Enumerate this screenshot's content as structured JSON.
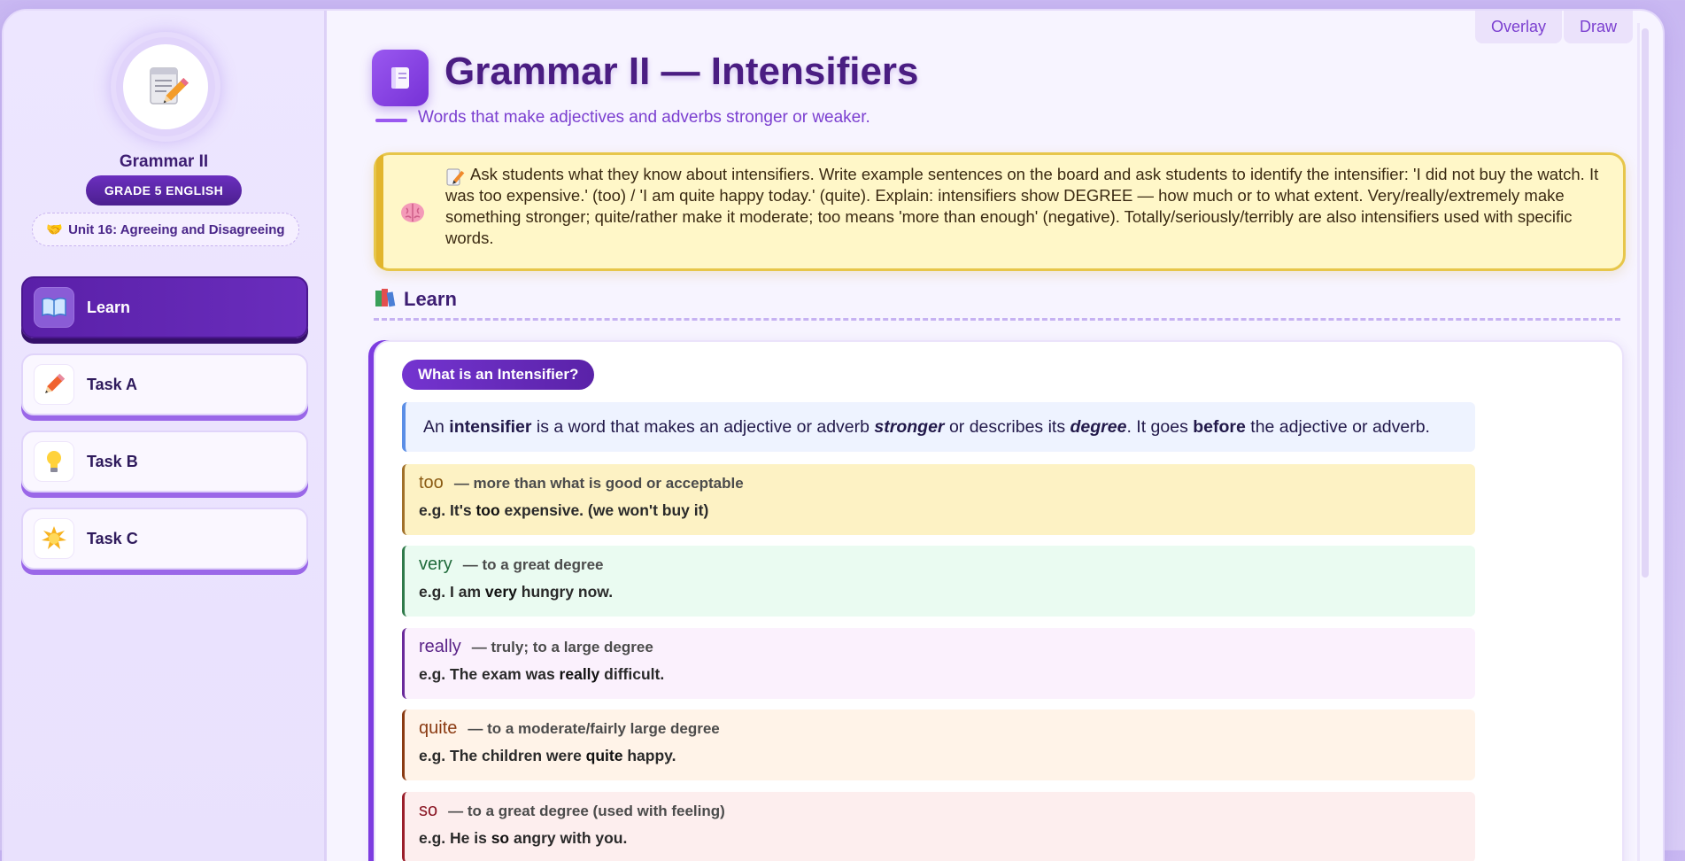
{
  "toolbar": {
    "overlay_label": "Overlay",
    "draw_label": "Draw"
  },
  "sidebar": {
    "unit_name": "Grammar II",
    "grade": "GRADE 5 ENGLISH",
    "unit_emoji": "🤝",
    "unit": "Unit 16: Agreeing and Disagreeing",
    "nav": [
      {
        "label": "Learn",
        "icon": "book-icon",
        "active": true
      },
      {
        "label": "Task A",
        "icon": "pencil-icon",
        "active": false
      },
      {
        "label": "Task B",
        "icon": "lightbulb-icon",
        "active": false
      },
      {
        "label": "Task C",
        "icon": "star-icon",
        "active": false
      }
    ]
  },
  "main": {
    "title": "Grammar II — Intensifiers",
    "subtitle": "Words that make adjectives and adverbs stronger or weaker.",
    "teacher_note": "Ask students what they know about intensifiers. Write example sentences on the board and ask students to identify the intensifier: 'I did not buy the watch. It was too expensive.' (too) / 'I am quite happy today.' (quite). Explain: intensifiers show DEGREE — how much or to what extent. Very/really/extremely make something stronger; quite/rather make it moderate; too means 'more than enough' (negative). Totally/seriously/terribly are also intensifiers used with specific words.",
    "section_title": "Learn",
    "card": {
      "pill": "What is an Intensifier?",
      "definition": {
        "p1": "An ",
        "b1": "intensifier",
        "p2": " is a word that makes an adjective or adverb ",
        "i1": "stronger",
        "p3": " or describes its ",
        "i2": "degree",
        "p4": ". It goes ",
        "b2": "before",
        "p5": " the adjective or adverb."
      },
      "words": [
        {
          "word": "too",
          "meaning": "— more than what is good or acceptable",
          "ex_pre": "e.g. It's ",
          "ex_word": "too",
          "ex_post": " expensive. (we won't buy it)",
          "bg": "#fdf2c4",
          "border": "#a0702a",
          "color": "#8a5a12"
        },
        {
          "word": "very",
          "meaning": "— to a great degree",
          "ex_pre": "e.g. I am ",
          "ex_word": "very",
          "ex_post": " hungry now.",
          "bg": "#eafbf1",
          "border": "#2f7a4a",
          "color": "#1f6a3a"
        },
        {
          "word": "really",
          "meaning": "— truly; to a large degree",
          "ex_pre": "e.g. The exam was ",
          "ex_word": "really",
          "ex_post": " difficult.",
          "bg": "#fbf1fd",
          "border": "#6a2a9a",
          "color": "#5a2388"
        },
        {
          "word": "quite",
          "meaning": "— to a moderate/fairly large degree",
          "ex_pre": "e.g. The children were ",
          "ex_word": "quite",
          "ex_post": " happy.",
          "bg": "#fff3e8",
          "border": "#8a3a12",
          "color": "#8a3a12"
        },
        {
          "word": "so",
          "meaning": "— to a great degree (used with feeling)",
          "ex_pre": "e.g. He is ",
          "ex_word": "so",
          "ex_post": " angry with you.",
          "bg": "#fdeeee",
          "border": "#9a1e2a",
          "color": "#8a1624"
        }
      ]
    }
  }
}
